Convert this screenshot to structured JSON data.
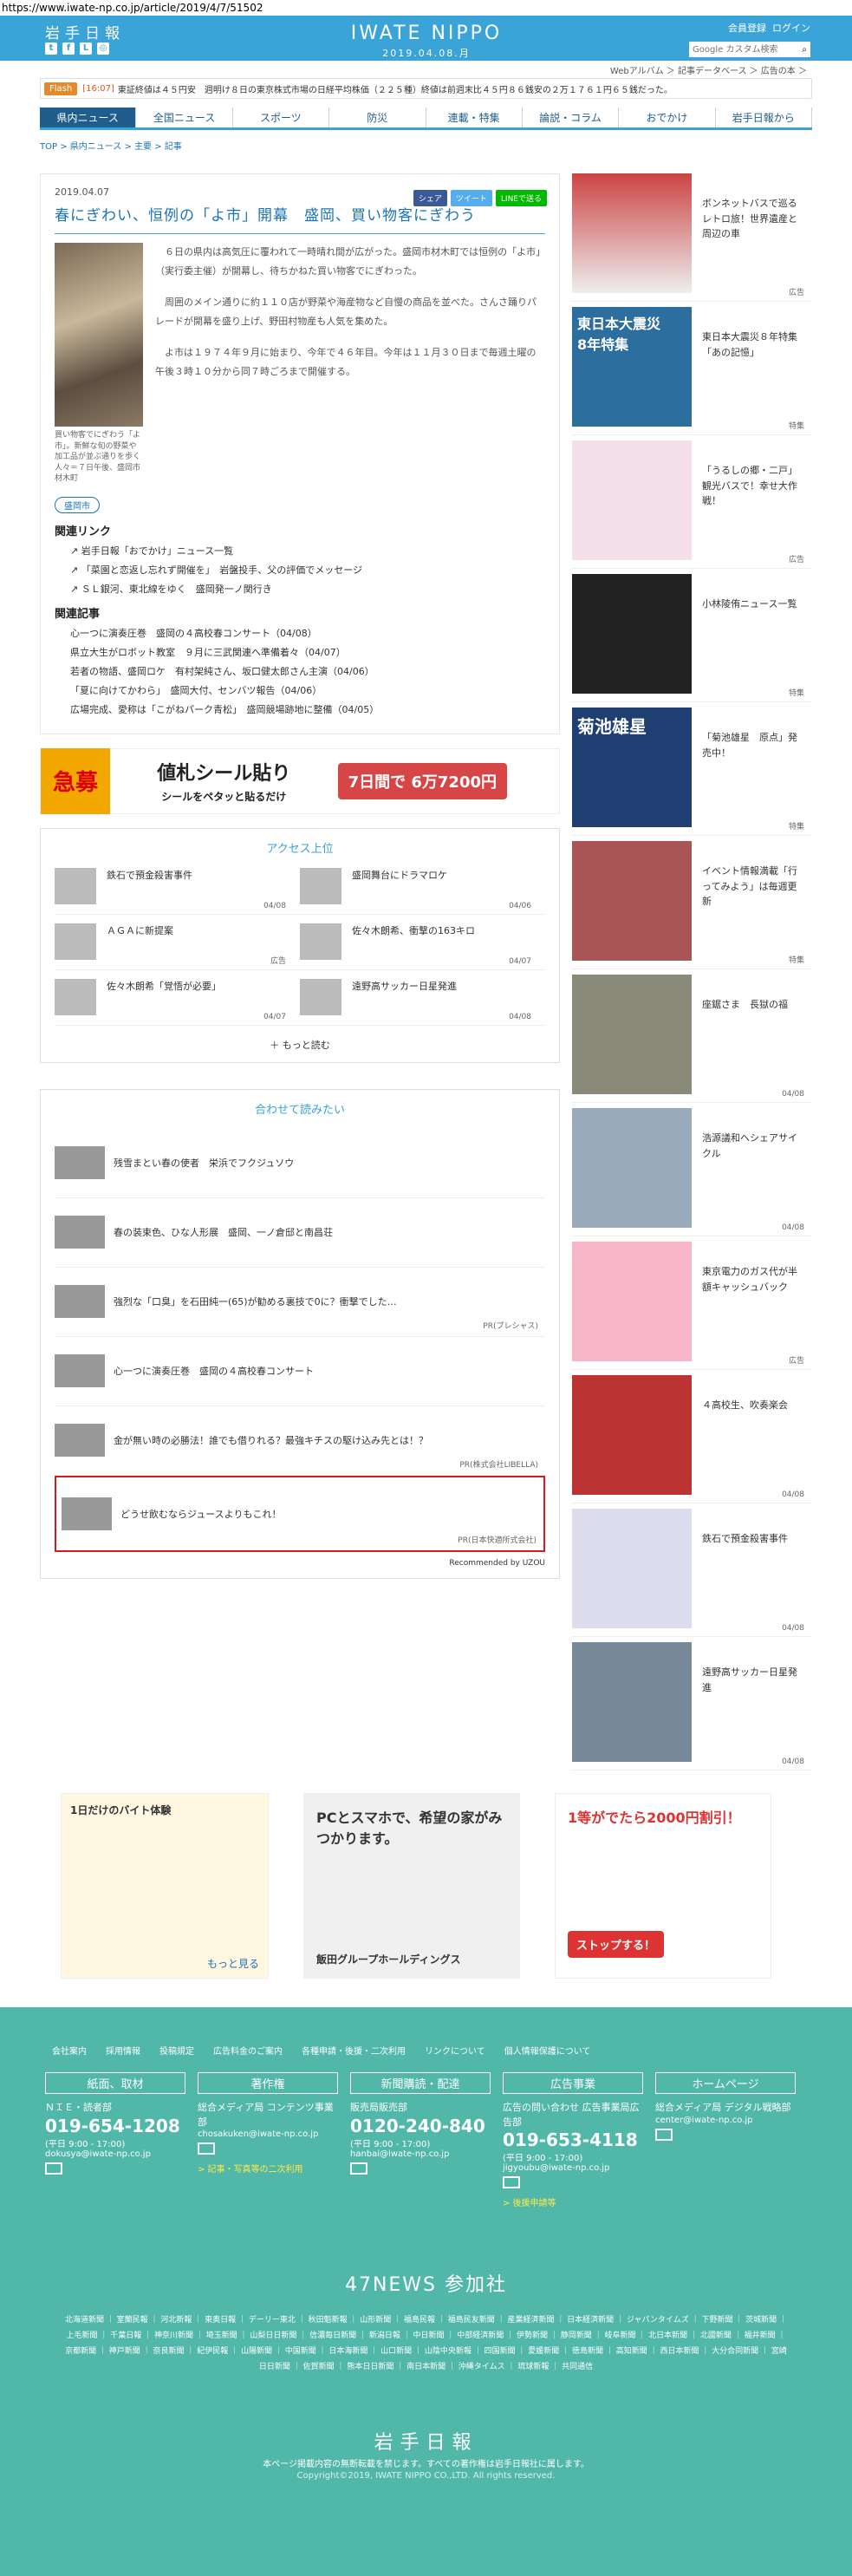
{
  "url": "https://www.iwate-np.co.jp/article/2019/4/7/51502",
  "header": {
    "brand": "岩手日報",
    "logo": "IWATE NIPPO",
    "date": "2019.04.08.月",
    "member": "会員登録",
    "login": "ログイン",
    "search_placeholder": "Google カスタム検索",
    "subnav": "Webアルバム ＞ 記事データベース ＞ 広告の本 ＞"
  },
  "flash": {
    "tag": "Flash",
    "time": "[16:07]",
    "message": "東証終値は４５円安　週明け８日の東京株式市場の日経平均株価（２２５種）終値は前週末比４５円８６銭安の２万１７６１円６５銭だった。"
  },
  "nav": [
    "県内ニュース",
    "全国ニュース",
    "スポーツ",
    "防災",
    "連載・特集",
    "論説・コラム",
    "おでかけ",
    "岩手日報から"
  ],
  "breadcrumb": [
    "TOP",
    "県内ニュース",
    "主要",
    "記事"
  ],
  "article": {
    "date": "2019.04.07",
    "share": [
      "シェア",
      "ツイート",
      "LINEで送る"
    ],
    "title": "春にぎわい、恒例の「よ市」開幕　盛岡、買い物客にぎわう",
    "caption": "買い物客でにぎわう「よ市」。新鮮な旬の野菜や加工品が並ぶ通りを歩く人々＝７日午後、盛岡市材木町",
    "paragraphs": [
      "６日の県内は高気圧に覆われて一時晴れ間が広がった。盛岡市材木町では恒例の「よ市」（実行委主催）が開幕し、待ちかねた買い物客でにぎわった。",
      "周囲のメイン通りに約１１０店が野菜や海産物など自慢の商品を並べた。さんさ踊りパレードが開幕を盛り上げ、野田村物産も人気を集めた。",
      "よ市は１９７４年９月に始まり、今年で４６年目。今年は１１月３０日まで毎週土曜の午後３時１０分から同７時ごろまで開催する。"
    ],
    "tag": "盛岡市"
  },
  "links_heading": "関連リンク",
  "links": [
    "岩手日報「おでかけ」ニュース一覧",
    "「菜園と恋返し忘れず開催を」　岩盤投手、父の評価でメッセージ",
    "ＳＬ銀河、東北線をゆく　盛岡発一ノ関行き"
  ],
  "related_heading": "関連記事",
  "related": [
    "心一つに演奏圧巻　盛岡の４高校春コンサート（04/08）",
    "県立大生がロボット教室　９月に三武関連へ準備着々（04/07）",
    "若者の物語、盛岡ロケ　有村架純さん、坂口健太郎さん主演（04/06）",
    "「夏に向けてかわら」　盛岡大付、センバツ報告（04/06）",
    "広場完成、愛称は「こがねパーク青松」　盛岡競場跡地に整備（04/05）"
  ],
  "ad": {
    "kyubo": "急募",
    "copy": "値札シール貼り",
    "sub": "シールをペタッと貼るだけ",
    "price": "7日間で 6万7200円"
  },
  "access": {
    "heading": "アクセス上位",
    "items": [
      {
        "t": "鉄石で預金殺害事件",
        "d": "04/08"
      },
      {
        "t": "盛岡舞台にドラマロケ",
        "d": "04/06"
      },
      {
        "t": "ＡＧＡに新提案",
        "d": "広告"
      },
      {
        "t": "佐々木朗希、衝撃の163キロ",
        "d": "04/07"
      },
      {
        "t": "佐々木朗希「覚悟が必要」",
        "d": "04/07"
      },
      {
        "t": "遠野高サッカー日星発進",
        "d": "04/08"
      }
    ],
    "more": "もっと読む"
  },
  "readmore": {
    "heading": "合わせて読みたい",
    "items": [
      {
        "t": "残雪まとい春の使者　栄浜でフクジュソウ",
        "pr": ""
      },
      {
        "t": "春の装束色、ひな人形展　盛岡、一ノ倉邸と南昌荘",
        "pr": ""
      },
      {
        "t": "強烈な「口臭」を石田純一(65)が勧める裏技で0に？衝撃でした…",
        "pr": "PR(プレシャス)"
      },
      {
        "t": "心一つに演奏圧巻　盛岡の４高校春コンサート",
        "pr": ""
      },
      {
        "t": "金が無い時の必勝法！誰でも借りれる？最強キチスの駆け込み先とは！？",
        "pr": "PR(株式会社LIBELLA)"
      },
      {
        "t": "どうせ飲むならジュースよりもこれ！",
        "pr": "PR(日本快適所式会社)"
      }
    ],
    "foot": "Recommended by UZOU"
  },
  "sidebar": [
    {
      "t": "ボンネットバスで巡るレトロ旅！世界遺産と周辺の車",
      "l": "広告"
    },
    {
      "t": "東日本大震災８年特集「あの記憶」",
      "l": "特集"
    },
    {
      "t": "「うるしの郷・二戸」観光バスで！幸せ大作戦！",
      "l": "広告"
    },
    {
      "t": "小林陵侑ニュース一覧",
      "l": "特集"
    },
    {
      "t": "「菊池雄星　原点」発売中！",
      "l": "特集"
    },
    {
      "t": "イベント情報満載「行ってみよう」は毎週更新",
      "l": "特集"
    },
    {
      "t": "座鋸さま　長獄の福",
      "l": "04/08"
    },
    {
      "t": "浩源議和へシェアサイクル",
      "l": "04/08"
    },
    {
      "t": "東京電力のガス代が半額キャッシュバック",
      "l": "広告"
    },
    {
      "t": "４高校生、吹奏楽会",
      "l": "04/08"
    },
    {
      "t": "鉄石で預金殺害事件",
      "l": "04/08"
    },
    {
      "t": "遠野高サッカー日星発進",
      "l": "04/08"
    }
  ],
  "sideheads": {
    "s1": "東日本大震災\n8年特集",
    "s2": "菊池雄星"
  },
  "bottomads": {
    "a1": "1日だけのバイト体験",
    "a1b": "もっと見る",
    "a2": "PCとスマホで、希望の家がみつかります。",
    "a2b": "飯田グループホールディングス",
    "a3": "1等がでたら2000円割引！",
    "a3b": "ストップする！"
  },
  "footer": {
    "links": [
      "会社案内",
      "採用情報",
      "投稿規定",
      "広告料金のご案内",
      "各種申請・後援・二次利用",
      "リンクについて",
      "個人情報保護について"
    ],
    "cols": [
      {
        "h": "紙面、取材",
        "s": "ＮＩＥ・読者部",
        "tel": "019-654-1208",
        "hours": "(平日 9:00 - 17:00)",
        "mail": "dokusya@iwate-np.co.jp",
        "y": ""
      },
      {
        "h": "著作権",
        "s": "総合メディア局 コンテンツ事業部",
        "tel": "",
        "hours": "",
        "mail": "chosakuken@iwate-np.co.jp",
        "y": "> 記事・写真等の二次利用"
      },
      {
        "h": "新聞購読・配達",
        "s": "販売局販売部",
        "tel": "0120-240-840",
        "hours": "(平日 9:00 - 17:00)",
        "mail": "hanbai@iwate-np.co.jp",
        "y": ""
      },
      {
        "h": "広告事業",
        "s": "広告の問い合わせ 広告事業局広告部",
        "tel": "019-653-4118",
        "hours": "(平日 9:00 - 17:00)",
        "mail": "jigyoubu@iwate-np.co.jp",
        "y": "> 後援申請等"
      },
      {
        "h": "ホームページ",
        "s": "総合メディア局 デジタル戦略部",
        "tel": "",
        "hours": "",
        "mail": "center@iwate-np.co.jp",
        "y": ""
      }
    ],
    "n47": "47NEWS 参加社",
    "papers": "北海道新聞 ｜ 室蘭民報 ｜ 河北新報 ｜ 東奥日報 ｜ デーリー東北 ｜ 秋田魁新報 ｜ 山形新聞 ｜ 福島民報 ｜ 福島民友新聞 ｜ 産業経済新聞 ｜ 日本経済新聞 ｜ ジャパンタイムズ ｜ 下野新聞 ｜ 茨城新聞 ｜ 上毛新聞 ｜ 千葉日報 ｜ 神奈川新聞 ｜ 埼玉新聞 ｜ 山梨日日新聞 ｜ 信濃毎日新聞 ｜ 新潟日報 ｜ 中日新聞 ｜ 中部経済新聞 ｜ 伊勢新聞 ｜ 静岡新聞 ｜ 岐阜新聞 ｜ 北日本新聞 ｜ 北國新聞 ｜ 福井新聞 ｜ 京都新聞 ｜ 神戸新聞 ｜ 奈良新聞 ｜ 紀伊民報 ｜ 山陽新聞 ｜ 中国新聞 ｜ 日本海新聞 ｜ 山口新聞 ｜ 山陰中央新報 ｜ 四国新聞 ｜ 愛媛新聞 ｜ 徳島新聞 ｜ 高知新聞 ｜ 西日本新聞 ｜ 大分合同新聞 ｜ 宮崎日日新聞 ｜ 佐賀新聞 ｜ 熊本日日新聞 ｜ 南日本新聞 ｜ 沖縄タイムス ｜ 琉球新報 ｜ 共同通信",
    "brand": "岩手日報",
    "copy": "本ページ掲載内容の無断転載を禁じます。すべての著作権は岩手日報社に属します。",
    "copy2": "Copyright©2019, IWATE NIPPO CO.,LTD. All rights reserved."
  }
}
